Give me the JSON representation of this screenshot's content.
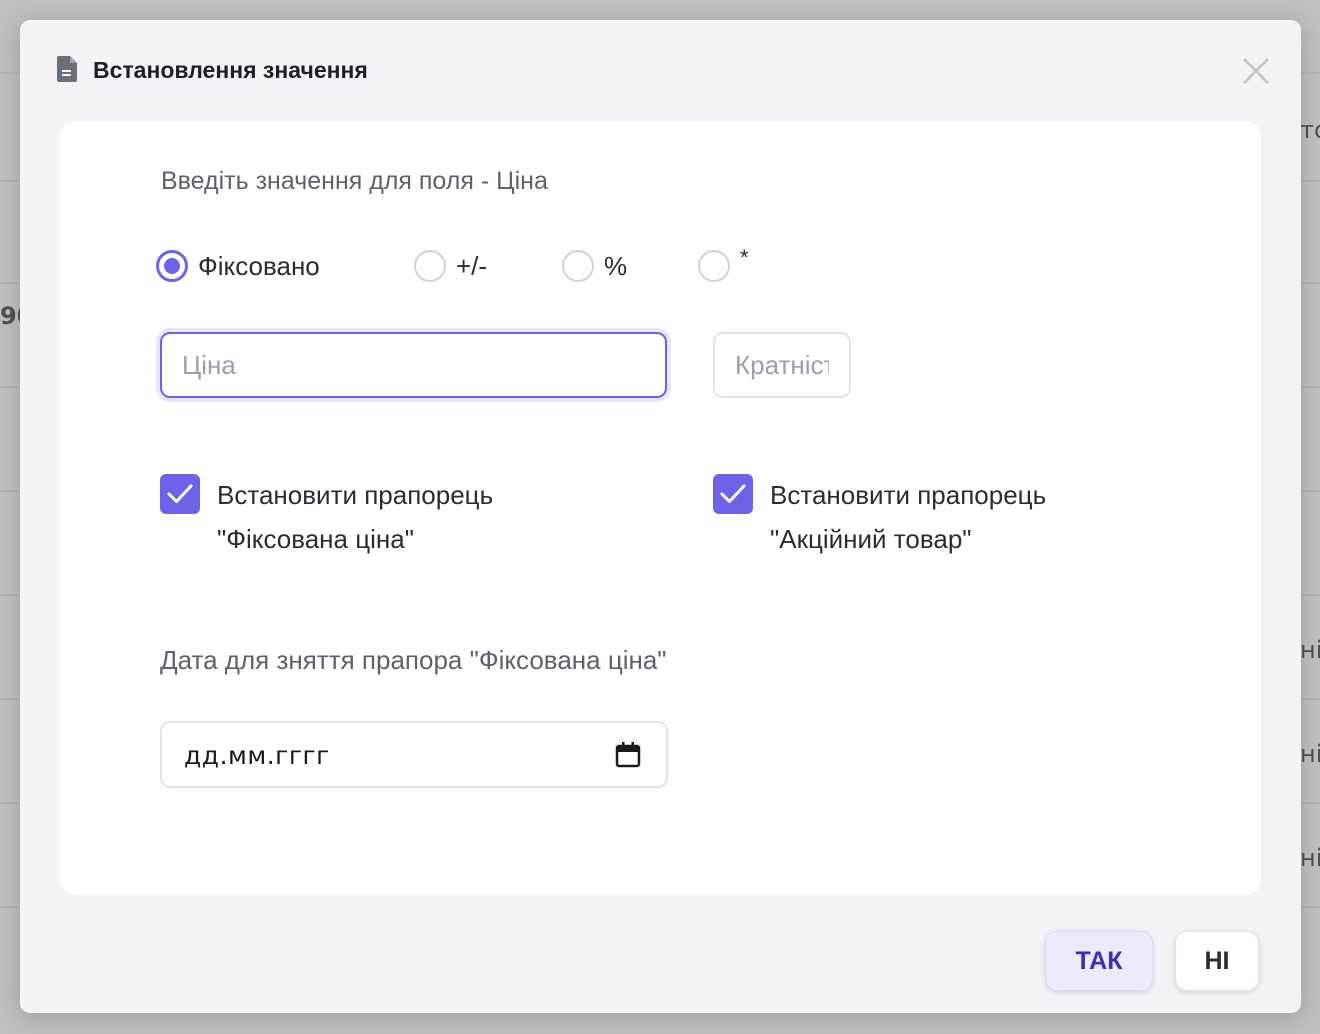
{
  "background": {
    "texts": [
      "90",
      "то",
      "ні",
      "ні",
      "ні"
    ]
  },
  "modal": {
    "title": "Встановлення значення",
    "icons": {
      "title": "document-icon",
      "close": "close-icon"
    },
    "prompt": "Введіть значення для поля - Ціна",
    "modes": [
      {
        "label": "Фіксовано",
        "checked": true
      },
      {
        "label": "+/-",
        "checked": false
      },
      {
        "label": "%",
        "checked": false
      },
      {
        "label": "*",
        "checked": false
      }
    ],
    "price_input": {
      "placeholder": "Ціна",
      "value": ""
    },
    "multiple_input": {
      "placeholder": "Кратність",
      "value": ""
    },
    "flags": [
      {
        "line1": "Встановити прапорець",
        "line2": "\"Фіксована ціна\"",
        "checked": true
      },
      {
        "line1": "Встановити прапорець",
        "line2": "\"Акційний товар\"",
        "checked": true
      }
    ],
    "date": {
      "label": "Дата для зняття прапора \"Фіксована ціна\"",
      "placeholder": "дд.мм.гггг"
    },
    "buttons": {
      "yes": "ТАК",
      "no": "НІ"
    },
    "colors": {
      "accent": "#6c63e8",
      "yes_text": "#3b2fb8"
    }
  }
}
